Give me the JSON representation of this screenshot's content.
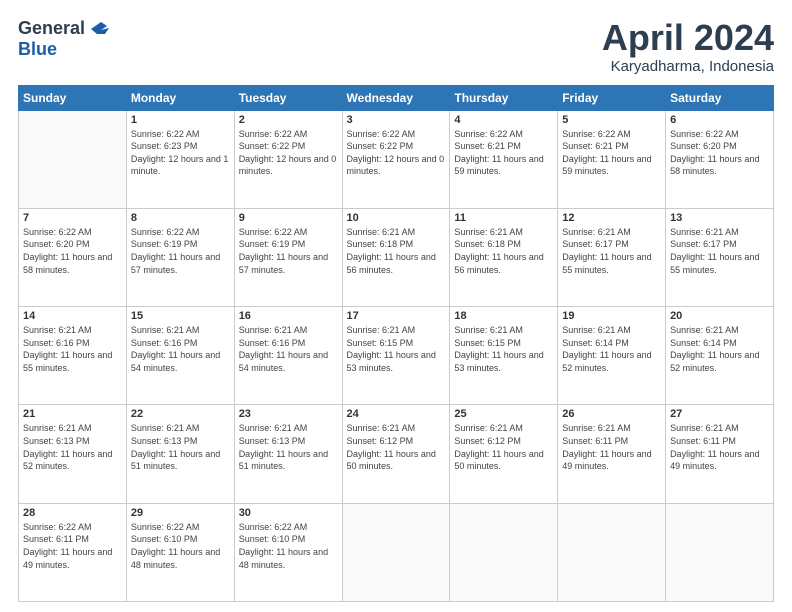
{
  "logo": {
    "general": "General",
    "blue": "Blue"
  },
  "title": "April 2024",
  "subtitle": "Karyadharma, Indonesia",
  "days_header": [
    "Sunday",
    "Monday",
    "Tuesday",
    "Wednesday",
    "Thursday",
    "Friday",
    "Saturday"
  ],
  "weeks": [
    [
      null,
      {
        "day": "1",
        "sunrise": "6:22 AM",
        "sunset": "6:23 PM",
        "daylight": "12 hours and 1 minute."
      },
      {
        "day": "2",
        "sunrise": "6:22 AM",
        "sunset": "6:22 PM",
        "daylight": "12 hours and 0 minutes."
      },
      {
        "day": "3",
        "sunrise": "6:22 AM",
        "sunset": "6:22 PM",
        "daylight": "12 hours and 0 minutes."
      },
      {
        "day": "4",
        "sunrise": "6:22 AM",
        "sunset": "6:21 PM",
        "daylight": "11 hours and 59 minutes."
      },
      {
        "day": "5",
        "sunrise": "6:22 AM",
        "sunset": "6:21 PM",
        "daylight": "11 hours and 59 minutes."
      },
      {
        "day": "6",
        "sunrise": "6:22 AM",
        "sunset": "6:20 PM",
        "daylight": "11 hours and 58 minutes."
      }
    ],
    [
      {
        "day": "7",
        "sunrise": "6:22 AM",
        "sunset": "6:20 PM",
        "daylight": "11 hours and 58 minutes."
      },
      {
        "day": "8",
        "sunrise": "6:22 AM",
        "sunset": "6:19 PM",
        "daylight": "11 hours and 57 minutes."
      },
      {
        "day": "9",
        "sunrise": "6:22 AM",
        "sunset": "6:19 PM",
        "daylight": "11 hours and 57 minutes."
      },
      {
        "day": "10",
        "sunrise": "6:21 AM",
        "sunset": "6:18 PM",
        "daylight": "11 hours and 56 minutes."
      },
      {
        "day": "11",
        "sunrise": "6:21 AM",
        "sunset": "6:18 PM",
        "daylight": "11 hours and 56 minutes."
      },
      {
        "day": "12",
        "sunrise": "6:21 AM",
        "sunset": "6:17 PM",
        "daylight": "11 hours and 55 minutes."
      },
      {
        "day": "13",
        "sunrise": "6:21 AM",
        "sunset": "6:17 PM",
        "daylight": "11 hours and 55 minutes."
      }
    ],
    [
      {
        "day": "14",
        "sunrise": "6:21 AM",
        "sunset": "6:16 PM",
        "daylight": "11 hours and 55 minutes."
      },
      {
        "day": "15",
        "sunrise": "6:21 AM",
        "sunset": "6:16 PM",
        "daylight": "11 hours and 54 minutes."
      },
      {
        "day": "16",
        "sunrise": "6:21 AM",
        "sunset": "6:16 PM",
        "daylight": "11 hours and 54 minutes."
      },
      {
        "day": "17",
        "sunrise": "6:21 AM",
        "sunset": "6:15 PM",
        "daylight": "11 hours and 53 minutes."
      },
      {
        "day": "18",
        "sunrise": "6:21 AM",
        "sunset": "6:15 PM",
        "daylight": "11 hours and 53 minutes."
      },
      {
        "day": "19",
        "sunrise": "6:21 AM",
        "sunset": "6:14 PM",
        "daylight": "11 hours and 52 minutes."
      },
      {
        "day": "20",
        "sunrise": "6:21 AM",
        "sunset": "6:14 PM",
        "daylight": "11 hours and 52 minutes."
      }
    ],
    [
      {
        "day": "21",
        "sunrise": "6:21 AM",
        "sunset": "6:13 PM",
        "daylight": "11 hours and 52 minutes."
      },
      {
        "day": "22",
        "sunrise": "6:21 AM",
        "sunset": "6:13 PM",
        "daylight": "11 hours and 51 minutes."
      },
      {
        "day": "23",
        "sunrise": "6:21 AM",
        "sunset": "6:13 PM",
        "daylight": "11 hours and 51 minutes."
      },
      {
        "day": "24",
        "sunrise": "6:21 AM",
        "sunset": "6:12 PM",
        "daylight": "11 hours and 50 minutes."
      },
      {
        "day": "25",
        "sunrise": "6:21 AM",
        "sunset": "6:12 PM",
        "daylight": "11 hours and 50 minutes."
      },
      {
        "day": "26",
        "sunrise": "6:21 AM",
        "sunset": "6:11 PM",
        "daylight": "11 hours and 49 minutes."
      },
      {
        "day": "27",
        "sunrise": "6:21 AM",
        "sunset": "6:11 PM",
        "daylight": "11 hours and 49 minutes."
      }
    ],
    [
      {
        "day": "28",
        "sunrise": "6:22 AM",
        "sunset": "6:11 PM",
        "daylight": "11 hours and 49 minutes."
      },
      {
        "day": "29",
        "sunrise": "6:22 AM",
        "sunset": "6:10 PM",
        "daylight": "11 hours and 48 minutes."
      },
      {
        "day": "30",
        "sunrise": "6:22 AM",
        "sunset": "6:10 PM",
        "daylight": "11 hours and 48 minutes."
      },
      null,
      null,
      null,
      null
    ]
  ]
}
